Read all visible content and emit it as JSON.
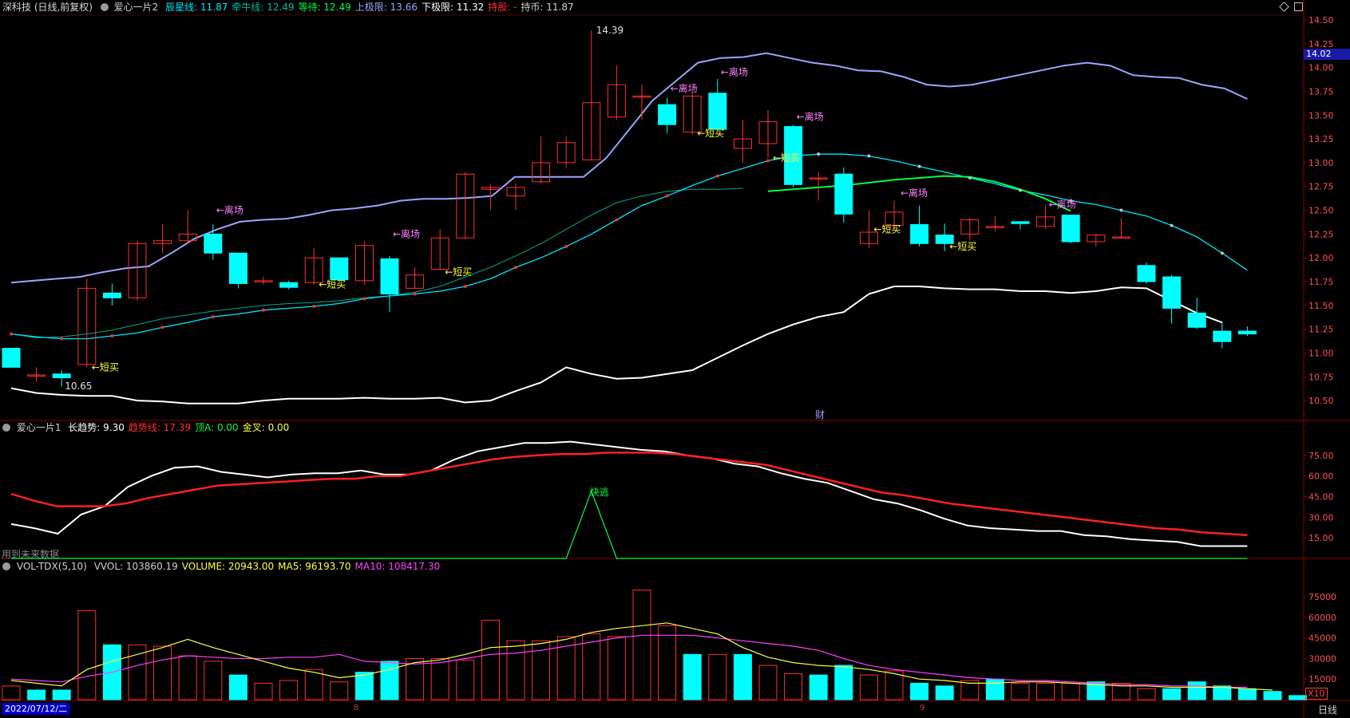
{
  "header": {
    "title": "深科技 (日线,前复权)",
    "indicator": "爱心一片2",
    "items": [
      {
        "label": "辰星线:",
        "value": "11.87",
        "color": "#00e5ff"
      },
      {
        "label": "牵牛线:",
        "value": "12.49",
        "color": "#00b8a0"
      },
      {
        "label": "等待:",
        "value": "12.49",
        "color": "#00ff40"
      },
      {
        "label": "上极限:",
        "value": "13.66",
        "color": "#9aa6ff"
      },
      {
        "label": "下极限:",
        "value": "11.32",
        "color": "#ffffff"
      },
      {
        "label": "持股:",
        "value": "-",
        "color": "#ff3030"
      },
      {
        "label": "持币:",
        "value": "11.87",
        "color": "#d0d0d0"
      }
    ]
  },
  "panel2_header": {
    "title": "爱心一片1",
    "items": [
      {
        "label": "长趋势:",
        "value": "9.30",
        "color": "#ffffff"
      },
      {
        "label": "趋势线:",
        "value": "17.39",
        "color": "#ff3030"
      },
      {
        "label": "顶A:",
        "value": "0.00",
        "color": "#00ff40"
      },
      {
        "label": "金叉:",
        "value": "0.00",
        "color": "#ffff40"
      }
    ]
  },
  "panel3_header": {
    "title": "VOL-TDX(5,10)",
    "items": [
      {
        "label": "VVOL:",
        "value": "103860.19",
        "color": "#d0d0d0"
      },
      {
        "label": "VOLUME:",
        "value": "20943.00",
        "color": "#ffff40"
      },
      {
        "label": "MA5:",
        "value": "96193.70",
        "color": "#ffff40"
      },
      {
        "label": "MA10:",
        "value": "108417.30",
        "color": "#ff40ff"
      }
    ]
  },
  "bottom": {
    "date": "2022/07/12/二",
    "mark1": "8",
    "mark2": "9",
    "period": "日线",
    "zoom": "X10"
  },
  "labels": {
    "future": "用到未来数据",
    "cai": "财",
    "price_tag": "14.02"
  },
  "icons": [
    "diamond-icon",
    "settings-square-icon",
    "collapse-circle-icon"
  ],
  "colors": {
    "up": "#ff3030",
    "down": "#00ffff",
    "upper_band": "#9aa6ff",
    "lower_band": "#ffffff",
    "mid_line": "#00e5ff",
    "green_line": "#00ff40",
    "ma5": "#ffff40",
    "ma10": "#ff40ff",
    "grid": "#8a0000"
  },
  "chart_data": [
    {
      "type": "candlestick",
      "title": "深科技 (日线,前复权)",
      "ylim": [
        10.3,
        14.55
      ],
      "y_ticks": [
        "14.50",
        "14.25",
        "14.00",
        "13.75",
        "13.50",
        "13.25",
        "13.00",
        "12.75",
        "12.50",
        "12.25",
        "12.00",
        "11.75",
        "11.50",
        "11.25",
        "11.00",
        "10.75",
        "10.50"
      ],
      "candles": [
        {
          "o": 11.05,
          "h": 11.05,
          "l": 10.85,
          "c": 10.85
        },
        {
          "o": 10.77,
          "h": 10.85,
          "l": 10.7,
          "c": 10.77
        },
        {
          "o": 10.78,
          "h": 10.82,
          "l": 10.65,
          "c": 10.74
        },
        {
          "o": 10.88,
          "h": 11.78,
          "l": 10.85,
          "c": 11.68
        },
        {
          "o": 11.63,
          "h": 11.73,
          "l": 11.5,
          "c": 11.58
        },
        {
          "o": 11.58,
          "h": 12.18,
          "l": 11.55,
          "c": 12.15
        },
        {
          "o": 12.15,
          "h": 12.35,
          "l": 12.05,
          "c": 12.18
        },
        {
          "o": 12.18,
          "h": 12.5,
          "l": 12.15,
          "c": 12.25
        },
        {
          "o": 12.25,
          "h": 12.35,
          "l": 11.98,
          "c": 12.05
        },
        {
          "o": 12.05,
          "h": 12.05,
          "l": 11.68,
          "c": 11.73
        },
        {
          "o": 11.76,
          "h": 11.8,
          "l": 11.72,
          "c": 11.76
        },
        {
          "o": 11.74,
          "h": 11.76,
          "l": 11.67,
          "c": 11.69
        },
        {
          "o": 11.74,
          "h": 12.1,
          "l": 11.72,
          "c": 12.0
        },
        {
          "o": 12.0,
          "h": 12.0,
          "l": 11.76,
          "c": 11.77
        },
        {
          "o": 11.76,
          "h": 12.17,
          "l": 11.72,
          "c": 12.13
        },
        {
          "o": 11.99,
          "h": 12.02,
          "l": 11.43,
          "c": 11.62
        },
        {
          "o": 11.68,
          "h": 11.9,
          "l": 11.68,
          "c": 11.82
        },
        {
          "o": 11.88,
          "h": 12.3,
          "l": 11.87,
          "c": 12.21
        },
        {
          "o": 12.21,
          "h": 12.9,
          "l": 12.2,
          "c": 12.88
        },
        {
          "o": 12.72,
          "h": 12.78,
          "l": 12.5,
          "c": 12.74
        },
        {
          "o": 12.65,
          "h": 12.78,
          "l": 12.5,
          "c": 12.74
        },
        {
          "o": 12.8,
          "h": 13.28,
          "l": 12.78,
          "c": 13.0
        },
        {
          "o": 13.0,
          "h": 13.28,
          "l": 12.95,
          "c": 13.21
        },
        {
          "o": 13.03,
          "h": 14.39,
          "l": 13.02,
          "c": 13.63
        },
        {
          "o": 13.48,
          "h": 14.02,
          "l": 13.45,
          "c": 13.82
        },
        {
          "o": 13.7,
          "h": 13.82,
          "l": 13.45,
          "c": 13.7
        },
        {
          "o": 13.61,
          "h": 13.68,
          "l": 13.31,
          "c": 13.4
        },
        {
          "o": 13.32,
          "h": 13.74,
          "l": 13.3,
          "c": 13.7
        },
        {
          "o": 13.73,
          "h": 13.88,
          "l": 13.33,
          "c": 13.35
        },
        {
          "o": 13.15,
          "h": 13.45,
          "l": 13.0,
          "c": 13.25
        },
        {
          "o": 13.2,
          "h": 13.55,
          "l": 13.05,
          "c": 13.43
        },
        {
          "o": 13.38,
          "h": 13.4,
          "l": 12.74,
          "c": 12.77
        },
        {
          "o": 12.84,
          "h": 12.9,
          "l": 12.6,
          "c": 12.84
        },
        {
          "o": 12.88,
          "h": 12.95,
          "l": 12.37,
          "c": 12.46
        },
        {
          "o": 12.15,
          "h": 12.5,
          "l": 12.1,
          "c": 12.27
        },
        {
          "o": 12.34,
          "h": 12.6,
          "l": 12.3,
          "c": 12.48
        },
        {
          "o": 12.35,
          "h": 12.55,
          "l": 12.12,
          "c": 12.15
        },
        {
          "o": 12.24,
          "h": 12.36,
          "l": 12.07,
          "c": 12.15
        },
        {
          "o": 12.25,
          "h": 12.42,
          "l": 12.18,
          "c": 12.4
        },
        {
          "o": 12.33,
          "h": 12.44,
          "l": 12.28,
          "c": 12.33
        },
        {
          "o": 12.38,
          "h": 12.38,
          "l": 12.3,
          "c": 12.36
        },
        {
          "o": 12.33,
          "h": 12.55,
          "l": 12.3,
          "c": 12.43
        },
        {
          "o": 12.45,
          "h": 12.45,
          "l": 12.15,
          "c": 12.17
        },
        {
          "o": 12.17,
          "h": 12.25,
          "l": 12.12,
          "c": 12.24
        },
        {
          "o": 12.22,
          "h": 12.42,
          "l": 12.2,
          "c": 12.22
        },
        {
          "o": 11.92,
          "h": 11.95,
          "l": 11.73,
          "c": 11.75
        },
        {
          "o": 11.8,
          "h": 11.82,
          "l": 11.31,
          "c": 11.47
        },
        {
          "o": 11.42,
          "h": 11.58,
          "l": 11.25,
          "c": 11.27
        },
        {
          "o": 11.23,
          "h": 11.32,
          "l": 11.05,
          "c": 11.12
        },
        {
          "o": 11.23,
          "h": 11.28,
          "l": 11.18,
          "c": 11.2
        }
      ],
      "upper_band": {
        "name": "上极限",
        "values": [
          11.74,
          11.76,
          11.78,
          11.8,
          11.85,
          11.89,
          11.91,
          12.05,
          12.2,
          12.3,
          12.38,
          12.4,
          12.41,
          12.45,
          12.5,
          12.52,
          12.55,
          12.6,
          12.62,
          12.62,
          12.63,
          12.65,
          12.85,
          12.85,
          12.85,
          12.85,
          13.05,
          13.35,
          13.65,
          13.85,
          14.05,
          14.1,
          14.11,
          14.15,
          14.1,
          14.05,
          14.02,
          13.97,
          13.96,
          13.9,
          13.82,
          13.8,
          13.82,
          13.87,
          13.92,
          13.97,
          14.02,
          14.05,
          14.02,
          13.92,
          13.9,
          13.89,
          13.82,
          13.78,
          13.67
        ]
      },
      "lower_band": {
        "name": "下极限",
        "values": [
          10.63,
          10.58,
          10.56,
          10.55,
          10.55,
          10.5,
          10.49,
          10.47,
          10.47,
          10.47,
          10.5,
          10.52,
          10.52,
          10.52,
          10.53,
          10.52,
          10.52,
          10.53,
          10.48,
          10.5,
          10.6,
          10.69,
          10.85,
          10.78,
          10.73,
          10.74,
          10.78,
          10.82,
          10.95,
          11.08,
          11.2,
          11.3,
          11.38,
          11.43,
          11.62,
          11.7,
          11.7,
          11.68,
          11.67,
          11.67,
          11.65,
          11.65,
          11.63,
          11.65,
          11.69,
          11.68,
          11.55,
          11.42,
          11.32
        ]
      },
      "mid_line": {
        "name": "辰星线",
        "values": [
          11.2,
          11.17,
          11.15,
          11.15,
          11.18,
          11.21,
          11.27,
          11.32,
          11.38,
          11.41,
          11.45,
          11.47,
          11.49,
          11.52,
          11.57,
          11.6,
          11.62,
          11.65,
          11.7,
          11.78,
          11.9,
          12.0,
          12.12,
          12.25,
          12.4,
          12.55,
          12.65,
          12.76,
          12.86,
          12.94,
          13.02,
          13.07,
          13.09,
          13.09,
          13.07,
          13.02,
          12.96,
          12.9,
          12.84,
          12.78,
          12.71,
          12.66,
          12.6,
          12.56,
          12.5,
          12.44,
          12.34,
          12.22,
          12.05,
          11.87
        ]
      },
      "slow_line": {
        "name": "牵牛线",
        "values": [
          11.2,
          11.16,
          11.17,
          11.2,
          11.24,
          11.3,
          11.36,
          11.4,
          11.44,
          11.47,
          11.5,
          11.52,
          11.53,
          11.55,
          11.58,
          11.6,
          11.64,
          11.7,
          11.8,
          11.9,
          12.02,
          12.15,
          12.3,
          12.45,
          12.58,
          12.65,
          12.7,
          12.72,
          12.72,
          12.73
        ]
      },
      "green_line": {
        "name": "等待",
        "values": [
          12.7,
          12.72,
          12.74,
          12.76,
          12.79,
          12.82,
          12.84,
          12.86,
          12.85,
          12.8,
          12.72,
          12.62,
          12.49
        ]
      },
      "annotations": [
        {
          "text": "14.39"
        },
        {
          "text": "10.65"
        },
        {
          "text": "←离场"
        },
        {
          "text": "←离场"
        },
        {
          "text": "←离场"
        },
        {
          "text": "←离场"
        },
        {
          "text": "←离场"
        },
        {
          "text": "←离场"
        },
        {
          "text": "←离场"
        },
        {
          "text": "←短买"
        },
        {
          "text": "←短买"
        },
        {
          "text": "←短买"
        },
        {
          "text": "←短买"
        },
        {
          "text": "←短买"
        },
        {
          "text": "←短买"
        },
        {
          "text": "←短买"
        }
      ]
    },
    {
      "type": "line",
      "title": "爱心一片1",
      "ylim": [
        0,
        90
      ],
      "y_ticks": [
        "75.00",
        "60.00",
        "45.00",
        "30.00",
        "15.00"
      ],
      "series": [
        {
          "name": "长趋势",
          "values": [
            25,
            22,
            18,
            32,
            38,
            52,
            60,
            66,
            67,
            63,
            61,
            59,
            61,
            62,
            62,
            64,
            61,
            61,
            64,
            72,
            78,
            81,
            84,
            84,
            85,
            83,
            81,
            79,
            78,
            75,
            73,
            69,
            67,
            62,
            58,
            55,
            49,
            43,
            40,
            35,
            29,
            24,
            22,
            21,
            20,
            20,
            17,
            16,
            14,
            13,
            12,
            9,
            9,
            9
          ]
        },
        {
          "name": "趋势线",
          "values": [
            47,
            42,
            38,
            38,
            38,
            40,
            44,
            47,
            50,
            53,
            54,
            55,
            56,
            57,
            58,
            58,
            60,
            60,
            63,
            66,
            69,
            72,
            74,
            75,
            76,
            76,
            77,
            77,
            77,
            76,
            74,
            72,
            70,
            68,
            64,
            60,
            56,
            52,
            48,
            46,
            43,
            40,
            38,
            36,
            34,
            32,
            30,
            28,
            26,
            24,
            22,
            21,
            19,
            18,
            17
          ]
        },
        {
          "name": "顶A",
          "values": [
            0,
            0,
            0,
            0,
            0,
            0,
            0,
            0,
            0,
            0,
            0,
            0,
            0,
            0,
            0,
            0,
            0,
            0,
            0,
            0,
            0,
            0,
            0,
            49,
            0,
            0,
            0,
            0,
            0,
            0,
            0,
            0,
            0,
            0,
            0,
            0,
            0,
            0,
            0,
            0,
            0,
            0,
            0,
            0,
            0,
            0,
            0,
            0,
            0,
            0
          ]
        }
      ],
      "annotations": [
        {
          "text": "快逃"
        }
      ]
    },
    {
      "type": "bar",
      "title": "VOL-TDX(5,10)",
      "ylim": [
        0,
        92000
      ],
      "y_ticks": [
        "75000",
        "60000",
        "45000",
        "30000",
        "15000"
      ],
      "values": [
        10000,
        7000,
        7000,
        65000,
        40000,
        40000,
        39000,
        32000,
        28000,
        18000,
        12000,
        14000,
        22000,
        13000,
        20000,
        28000,
        30000,
        30000,
        29000,
        58000,
        43000,
        43000,
        46000,
        48000,
        46000,
        80000,
        54000,
        33000,
        33000,
        33000,
        25000,
        19000,
        18000,
        25000,
        18000,
        21000,
        12000,
        10000,
        14000,
        15000,
        12000,
        12000,
        12000,
        13000,
        12000,
        8000,
        8000,
        13000,
        10000,
        8000,
        6000,
        3000
      ],
      "up": [
        true,
        false,
        false,
        true,
        false,
        true,
        true,
        true,
        true,
        false,
        true,
        true,
        true,
        true,
        false,
        false,
        true,
        true,
        true,
        true,
        true,
        true,
        true,
        true,
        true,
        true,
        true,
        false,
        true,
        false,
        true,
        true,
        false,
        false,
        true,
        true,
        false,
        false,
        true,
        false,
        true,
        true,
        true,
        false,
        true,
        true,
        false,
        false,
        false,
        false,
        false,
        false
      ],
      "series": [
        {
          "name": "MA5",
          "values": [
            14000,
            12000,
            10000,
            22000,
            28000,
            33000,
            38000,
            44000,
            38000,
            33000,
            28000,
            23000,
            20000,
            16000,
            18000,
            22000,
            27000,
            29000,
            33000,
            38000,
            39000,
            41000,
            44000,
            49000,
            52000,
            54000,
            56000,
            52000,
            48000,
            38000,
            31000,
            27000,
            25000,
            24000,
            22000,
            19000,
            15000,
            14000,
            12000,
            12000,
            13000,
            13000,
            12000,
            11000,
            10000,
            10000,
            9000,
            9000,
            9000,
            8000,
            7000
          ]
        },
        {
          "name": "MA10",
          "values": [
            15000,
            14000,
            13000,
            17000,
            20000,
            25000,
            29000,
            32000,
            31000,
            30000,
            30000,
            31000,
            31000,
            33000,
            28000,
            27000,
            26000,
            27000,
            30000,
            33000,
            34000,
            36000,
            39000,
            42000,
            45000,
            47000,
            47000,
            47000,
            45000,
            43000,
            41000,
            39000,
            36000,
            30000,
            25000,
            22000,
            20000,
            18000,
            16000,
            15000,
            14000,
            14000,
            13000,
            12000,
            11000,
            11000,
            10000,
            10000,
            9000,
            9000
          ]
        }
      ]
    }
  ]
}
